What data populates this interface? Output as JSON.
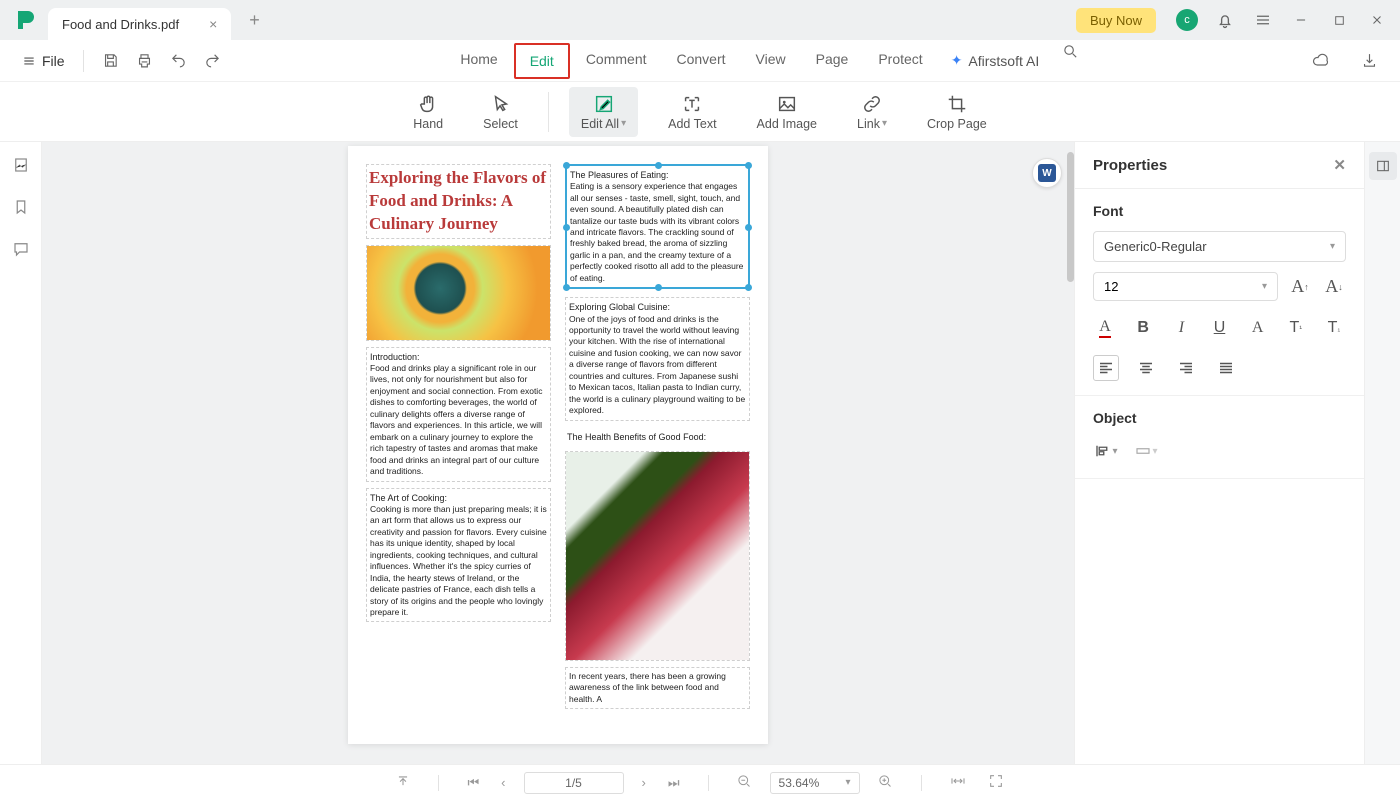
{
  "titlebar": {
    "tab_title": "Food and Drinks.pdf",
    "buy_now": "Buy Now",
    "avatar": "c"
  },
  "mainbar": {
    "file": "File",
    "menu": [
      "Home",
      "Edit",
      "Comment",
      "Convert",
      "View",
      "Page",
      "Protect"
    ],
    "ai": "Afirstsoft AI"
  },
  "ribbon": {
    "hand": "Hand",
    "select": "Select",
    "edit_all": "Edit All",
    "add_text": "Add Text",
    "add_image": "Add Image",
    "link": "Link",
    "crop_page": "Crop Page"
  },
  "document": {
    "title": "Exploring the Flavors of Food and Drinks: A Culinary Journey",
    "intro_hdr": "Introduction:",
    "intro": "Food and drinks play a significant role in our lives, not only for nourishment but also for enjoyment and social connection. From exotic dishes to comforting beverages, the world of culinary delights offers a diverse range of flavors and experiences. In this article, we will embark on a culinary journey to explore the rich tapestry of tastes and aromas that make food and drinks an integral part of our culture and traditions.",
    "art_hdr": "The Art of Cooking:",
    "art": "Cooking is more than just preparing meals; it is an art form that allows us to express our creativity and passion for flavors. Every cuisine has its unique identity, shaped by local ingredients, cooking techniques, and cultural influences. Whether it's the spicy curries of India, the hearty stews of Ireland, or the delicate pastries of France, each dish tells a story of its origins and the people who lovingly prepare it.",
    "pleasures_hdr": "The Pleasures of Eating:",
    "pleasures": "Eating is a sensory experience that engages all our senses - taste, smell, sight, touch, and even sound. A beautifully plated dish can tantalize our taste buds with its vibrant colors and intricate flavors. The crackling sound of freshly baked bread, the aroma of sizzling garlic in a pan, and the creamy texture of a perfectly cooked risotto all add to the pleasure of eating.",
    "global_hdr": "Exploring Global Cuisine:",
    "global": "One of the joys of food and drinks is the opportunity to travel the world without leaving your kitchen. With the rise of international cuisine and fusion cooking, we can now savor a diverse range of flavors from different countries and cultures. From Japanese sushi to Mexican tacos, Italian pasta to Indian curry, the world is a culinary playground waiting to be explored.",
    "health_hdr": "The Health Benefits of Good Food:",
    "health": "In recent years, there has been a growing awareness of the link between food and health. A",
    "word_badge": "W"
  },
  "properties": {
    "title": "Properties",
    "font_section": "Font",
    "font_family": "Generic0-Regular",
    "font_size": "12",
    "object_section": "Object"
  },
  "bottombar": {
    "page": "1/5",
    "zoom": "53.64%"
  }
}
